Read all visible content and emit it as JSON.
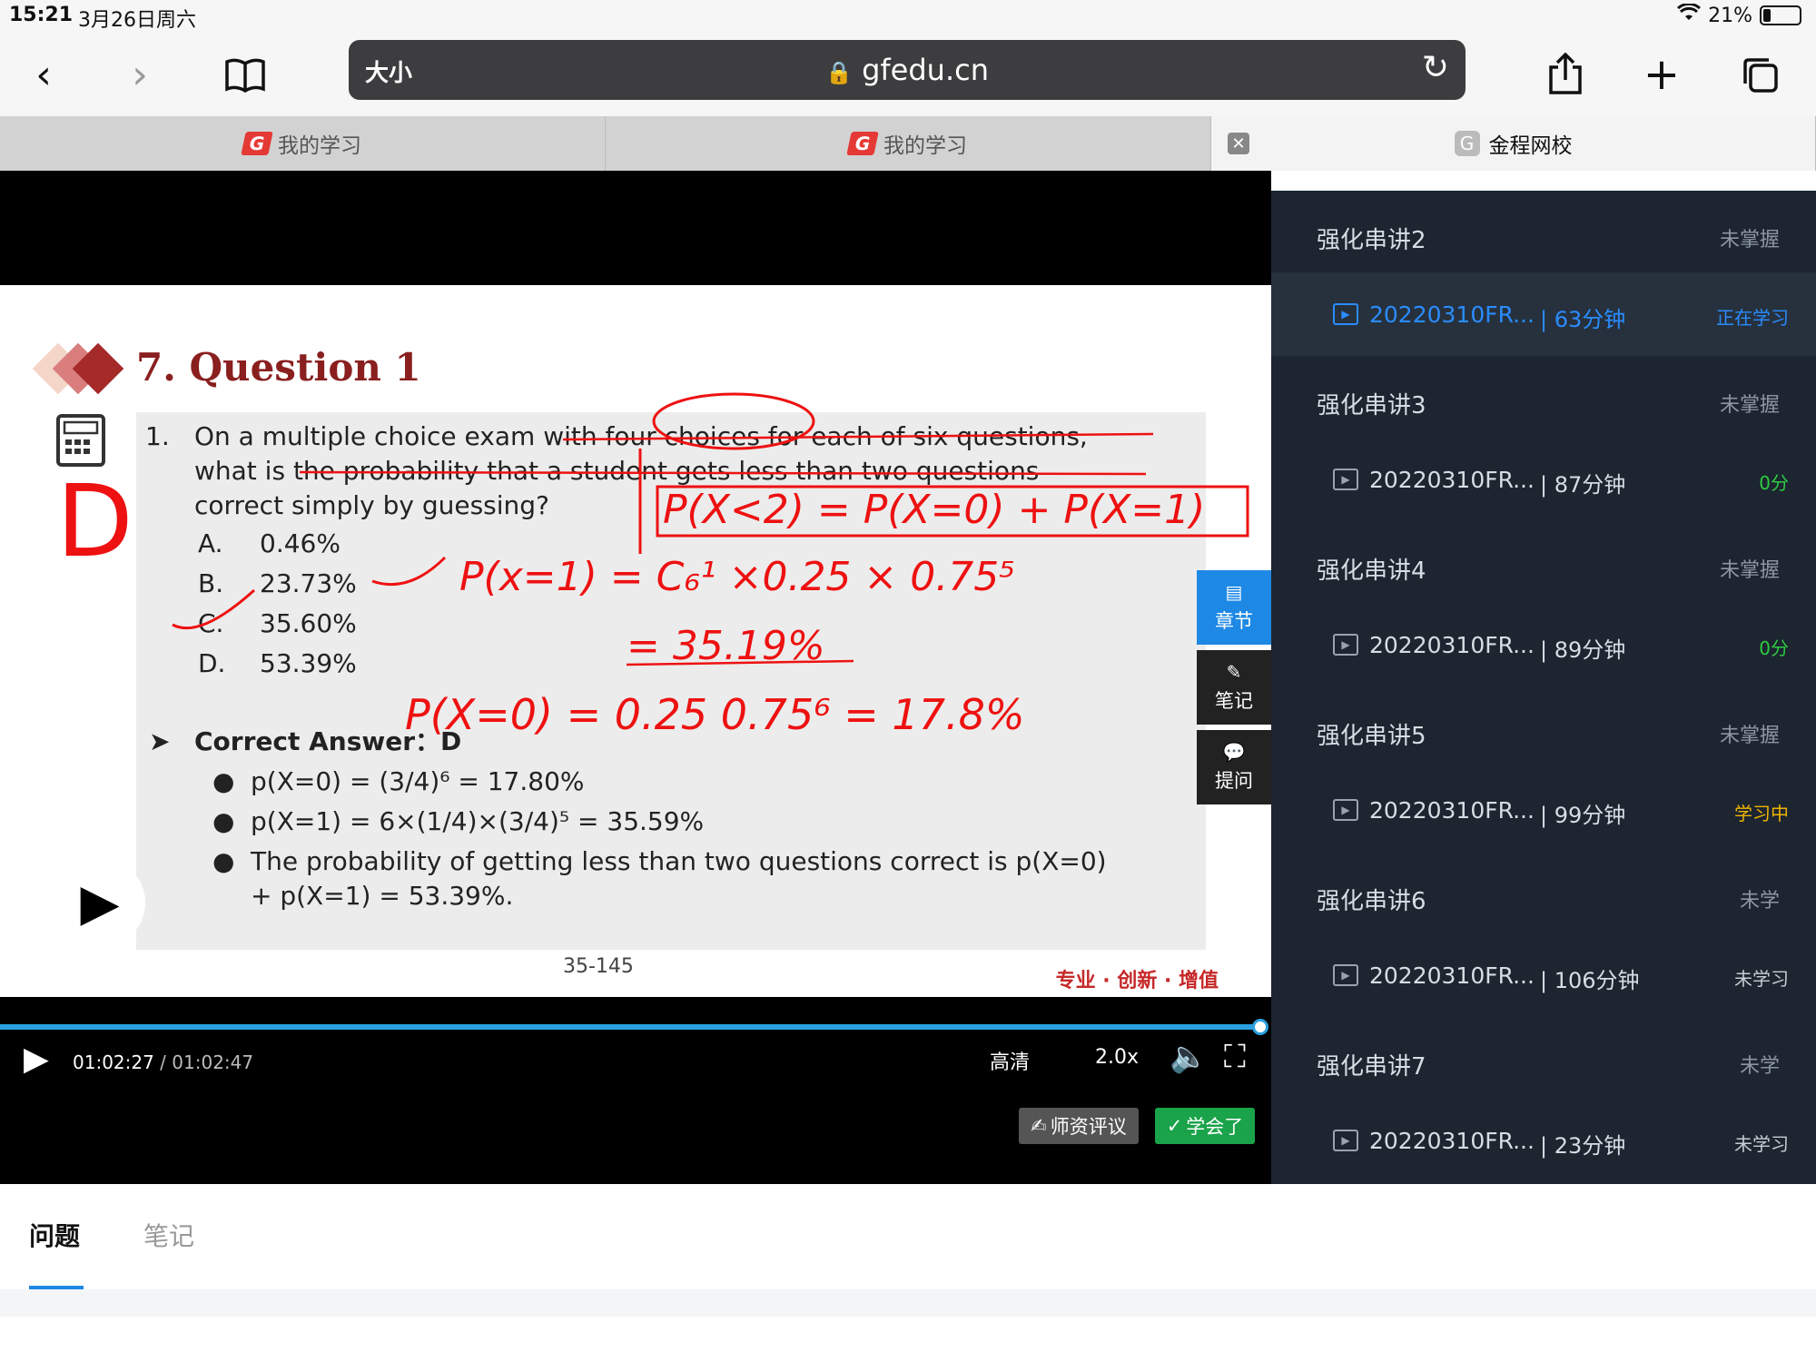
{
  "status": {
    "time": "15:21",
    "date": "3月26日周六",
    "battery": "21%",
    "battery_level": 0.21
  },
  "browser": {
    "text_size": "大小",
    "url": "gfedu.cn"
  },
  "tabs": [
    {
      "label": "我的学习"
    },
    {
      "label": "我的学习"
    },
    {
      "label": "金程网校",
      "favicon": "G"
    }
  ],
  "slide": {
    "title": "7. Question 1",
    "question_number": "1.",
    "question_lines": [
      "On a multiple choice exam with four choices for each of six questions,",
      "what is the probability that a student gets less than two questions",
      "correct simply by guessing?"
    ],
    "options": [
      {
        "letter": "A.",
        "value": "0.46%"
      },
      {
        "letter": "B.",
        "value": "23.73%"
      },
      {
        "letter": "C.",
        "value": "35.60%"
      },
      {
        "letter": "D.",
        "value": "53.39%"
      }
    ],
    "answer_heading": "Correct Answer：D",
    "bullets": [
      "p(X=0) = (3/4)⁶ = 17.80%",
      "p(X=1) = 6×(1/4)×(3/4)⁵ = 35.59%",
      "The probability of getting less than two questions correct is p(X=0)",
      "+ p(X=1) = 53.39%."
    ],
    "page": "35-145",
    "brand": "专业 · 创新 · 增值",
    "handwriting": {
      "answer": "D",
      "eq1": "P(X<2) = P(X=0) + P(X=1)",
      "eq2": "P(x=1) = C₆¹ ×0.25 × 0.75⁵",
      "eq3": "= 35.19%",
      "eq4": "P(X=0) = 0.25 0.75⁶ = 17.8%"
    }
  },
  "side_buttons": {
    "chapter": "章节",
    "notes": "笔记",
    "ask": "提问"
  },
  "player": {
    "current": "01:02:27",
    "separator": " / ",
    "duration": "01:02:47",
    "progress": 0.995,
    "quality": "高清",
    "speed": "2.0x",
    "review_button": "师资评议",
    "learned_button": "学会了"
  },
  "playlist": [
    {
      "chapter": "强化串讲2",
      "chapter_status": "未掌握",
      "lesson": "20220310FR...",
      "length": "| 63分钟",
      "status": "正在学习",
      "status_color": "#2a8cff",
      "active": true
    },
    {
      "chapter": "强化串讲3",
      "chapter_status": "未掌握",
      "lesson": "20220310FR...",
      "length": "| 87分钟",
      "status": "0分",
      "status_color": "#2ecc40"
    },
    {
      "chapter": "强化串讲4",
      "chapter_status": "未掌握",
      "lesson": "20220310FR...",
      "length": "| 89分钟",
      "status": "0分",
      "status_color": "#2ecc40"
    },
    {
      "chapter": "强化串讲5",
      "chapter_status": "未掌握",
      "lesson": "20220310FR...",
      "length": "| 99分钟",
      "status": "学习中",
      "status_color": "#f0b400"
    },
    {
      "chapter": "强化串讲6",
      "chapter_status": "未学",
      "lesson": "20220310FR...",
      "length": "| 106分钟",
      "status": "未学习",
      "status_color": "#c7cdd3"
    },
    {
      "chapter": "强化串讲7",
      "chapter_status": "未学",
      "lesson": "20220310FR...",
      "length": "| 23分钟",
      "status": "未学习",
      "status_color": "#c7cdd3"
    }
  ],
  "bottom_tabs": {
    "questions": "问题",
    "notes": "笔记"
  }
}
